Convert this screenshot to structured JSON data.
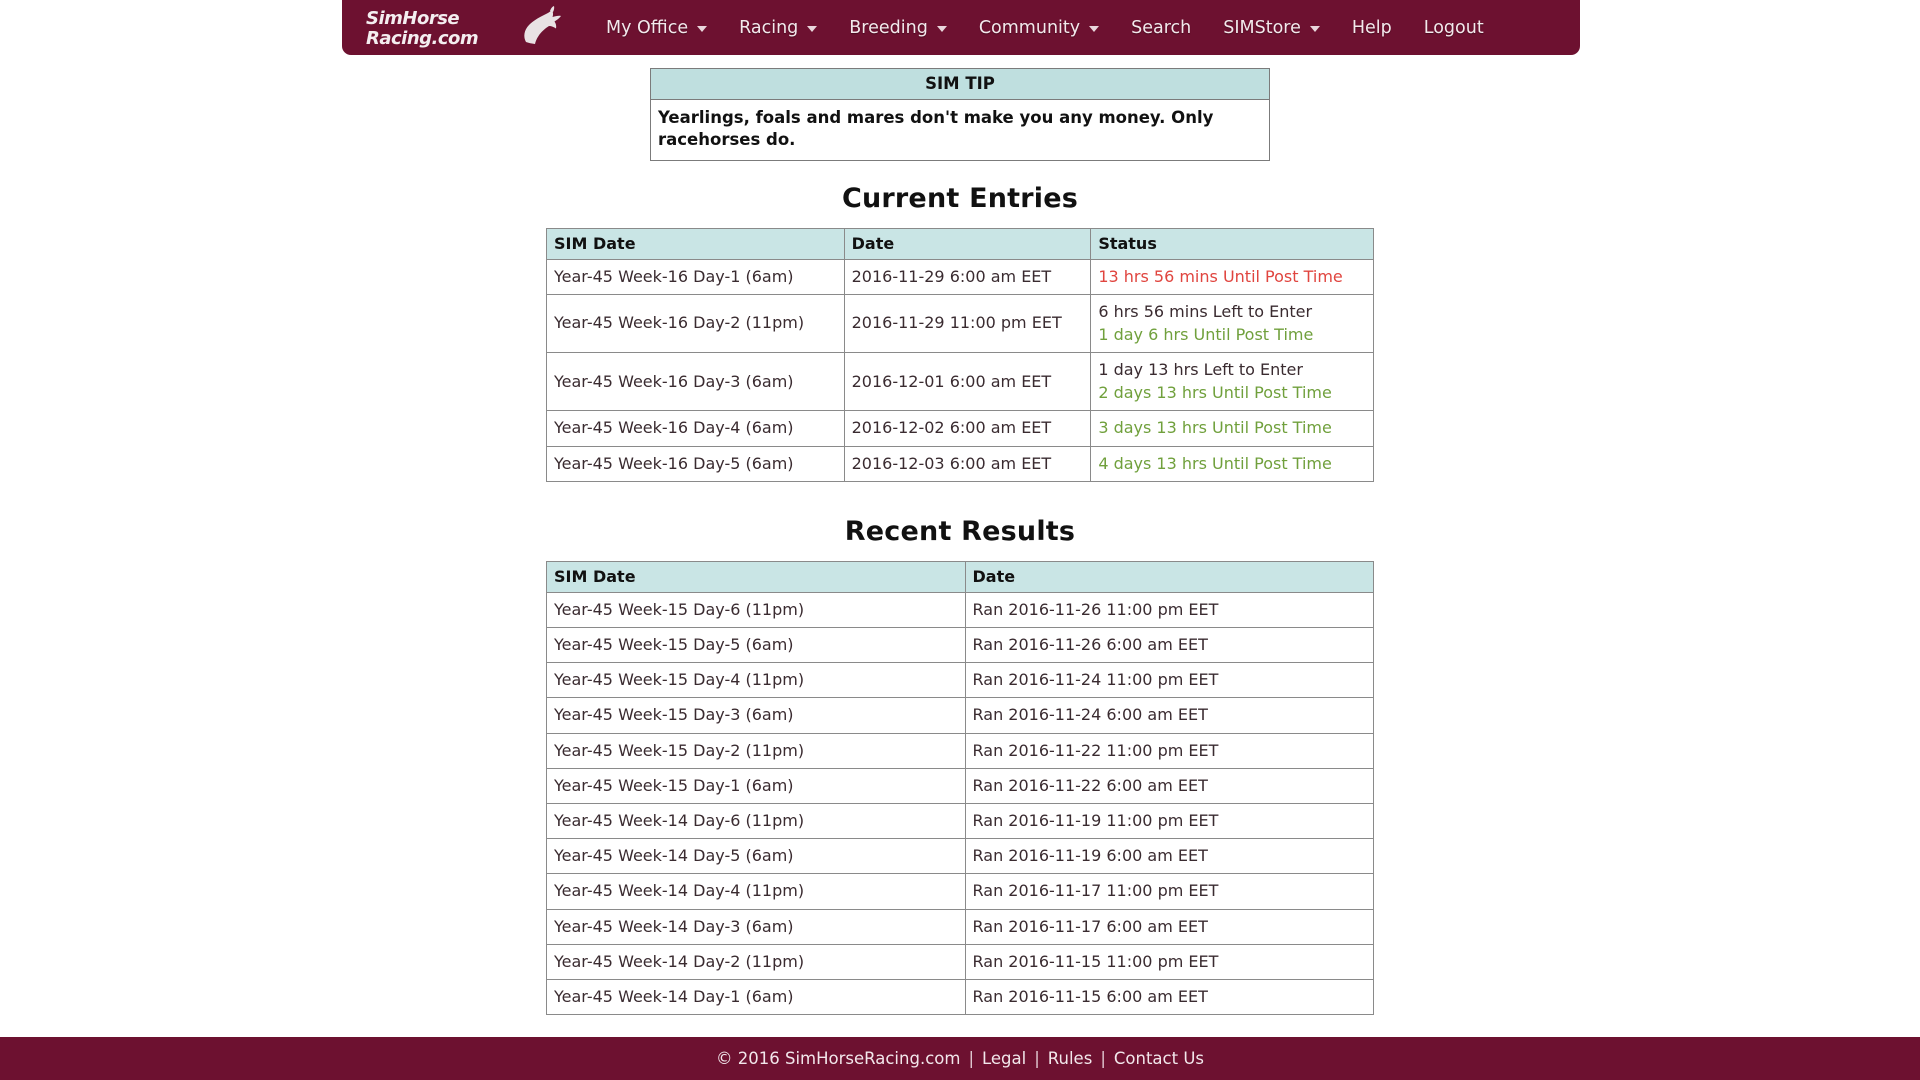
{
  "site": {
    "brand_line1": "SimHorse",
    "brand_line2": "Racing.com",
    "accent_maroon": "#6d1130",
    "accent_teal": "#c9e5e5",
    "status_red": "#e0453f",
    "status_green": "#70a03c"
  },
  "nav": {
    "items": [
      {
        "label": "My Office",
        "has_caret": true
      },
      {
        "label": "Racing",
        "has_caret": true
      },
      {
        "label": "Breeding",
        "has_caret": true
      },
      {
        "label": "Community",
        "has_caret": true
      },
      {
        "label": "Search",
        "has_caret": false
      },
      {
        "label": "SIMStore",
        "has_caret": true
      },
      {
        "label": "Help",
        "has_caret": false
      },
      {
        "label": "Logout",
        "has_caret": false
      }
    ]
  },
  "simtip": {
    "heading": "SIM TIP",
    "text": "Yearlings, foals and mares don't make you any money. Only racehorses do."
  },
  "current_entries": {
    "title": "Current Entries",
    "columns": [
      "SIM Date",
      "Date",
      "Status"
    ],
    "rows": [
      {
        "sim_date": "Year-45 Week-16 Day-1 (6am)",
        "date": "2016-11-29 6:00 am EET",
        "status_lines": [
          {
            "text": "13 hrs 56 mins Until Post Time",
            "color": "red"
          }
        ]
      },
      {
        "sim_date": "Year-45 Week-16 Day-2 (11pm)",
        "date": "2016-11-29 11:00 pm EET",
        "status_lines": [
          {
            "text": "6 hrs 56 mins Left to Enter",
            "color": "dark"
          },
          {
            "text": "1 day 6 hrs Until Post Time",
            "color": "green"
          }
        ]
      },
      {
        "sim_date": "Year-45 Week-16 Day-3 (6am)",
        "date": "2016-12-01 6:00 am EET",
        "status_lines": [
          {
            "text": "1 day 13 hrs Left to Enter",
            "color": "dark"
          },
          {
            "text": "2 days 13 hrs Until Post Time",
            "color": "green"
          }
        ]
      },
      {
        "sim_date": "Year-45 Week-16 Day-4 (6am)",
        "date": "2016-12-02 6:00 am EET",
        "status_lines": [
          {
            "text": "3 days 13 hrs Until Post Time",
            "color": "green"
          }
        ]
      },
      {
        "sim_date": "Year-45 Week-16 Day-5 (6am)",
        "date": "2016-12-03 6:00 am EET",
        "status_lines": [
          {
            "text": "4 days 13 hrs Until Post Time",
            "color": "green"
          }
        ]
      }
    ]
  },
  "recent_results": {
    "title": "Recent Results",
    "columns": [
      "SIM Date",
      "Date"
    ],
    "rows": [
      {
        "sim_date": "Year-45 Week-15 Day-6 (11pm)",
        "date": "Ran 2016-11-26 11:00 pm EET"
      },
      {
        "sim_date": "Year-45 Week-15 Day-5 (6am)",
        "date": "Ran 2016-11-26 6:00 am EET"
      },
      {
        "sim_date": "Year-45 Week-15 Day-4 (11pm)",
        "date": "Ran 2016-11-24 11:00 pm EET"
      },
      {
        "sim_date": "Year-45 Week-15 Day-3 (6am)",
        "date": "Ran 2016-11-24 6:00 am EET"
      },
      {
        "sim_date": "Year-45 Week-15 Day-2 (11pm)",
        "date": "Ran 2016-11-22 11:00 pm EET"
      },
      {
        "sim_date": "Year-45 Week-15 Day-1 (6am)",
        "date": "Ran 2016-11-22 6:00 am EET"
      },
      {
        "sim_date": "Year-45 Week-14 Day-6 (11pm)",
        "date": "Ran 2016-11-19 11:00 pm EET"
      },
      {
        "sim_date": "Year-45 Week-14 Day-5 (6am)",
        "date": "Ran 2016-11-19 6:00 am EET"
      },
      {
        "sim_date": "Year-45 Week-14 Day-4 (11pm)",
        "date": "Ran 2016-11-17 11:00 pm EET"
      },
      {
        "sim_date": "Year-45 Week-14 Day-3 (6am)",
        "date": "Ran 2016-11-17 6:00 am EET"
      },
      {
        "sim_date": "Year-45 Week-14 Day-2 (11pm)",
        "date": "Ran 2016-11-15 11:00 pm EET"
      },
      {
        "sim_date": "Year-45 Week-14 Day-1 (6am)",
        "date": "Ran 2016-11-15 6:00 am EET"
      }
    ]
  },
  "footer": {
    "copyright": "© 2016 SimHorseRacing.com",
    "separator": "|",
    "links": [
      "Legal",
      "Rules",
      "Contact Us"
    ]
  }
}
